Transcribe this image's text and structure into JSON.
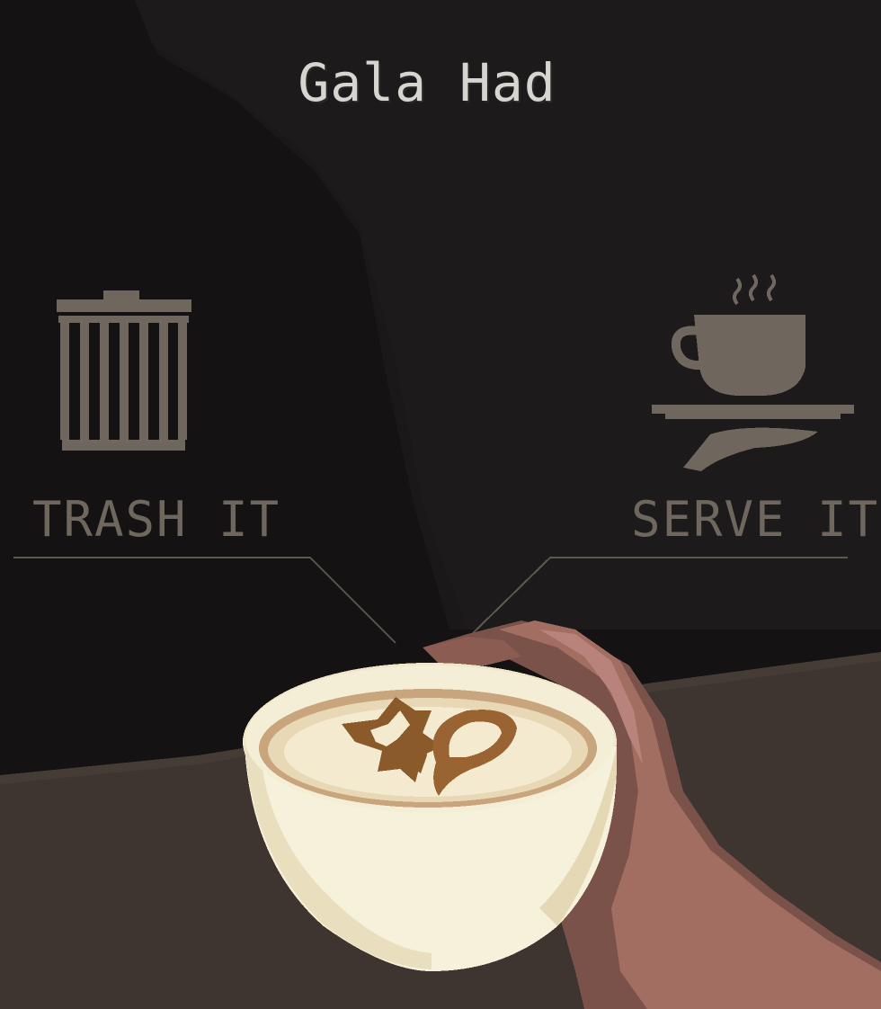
{
  "drink": {
    "name": "Gala Had"
  },
  "actions": {
    "trash_label": "TRASH IT",
    "serve_label": "SERVE IT"
  },
  "icons": {
    "trash": "trash-can-icon",
    "serve": "serving-tray-coffee-icon"
  },
  "colors": {
    "background": "#141213",
    "counter": "#3e3530",
    "title_text": "#d8d4cf",
    "ui_muted": "#6f675d",
    "cup": "#f6f1da",
    "latte_art": "#8a5a2b",
    "hand": "#a36e62"
  }
}
